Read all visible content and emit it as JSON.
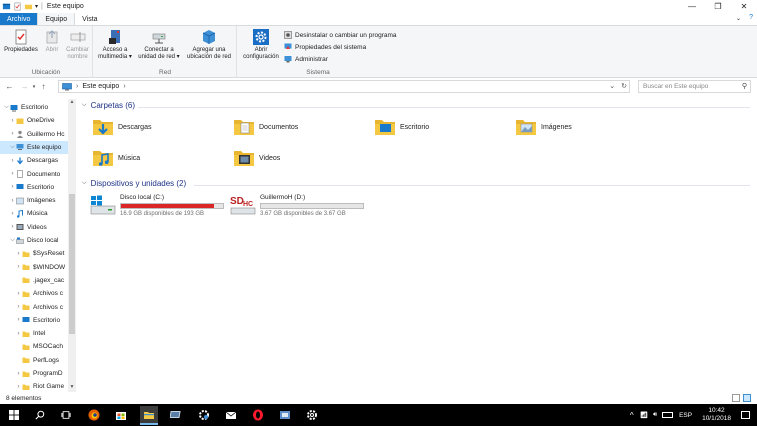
{
  "window": {
    "title": "Este equipo"
  },
  "tabs": [
    {
      "label": "Archivo"
    },
    {
      "label": "Equipo"
    },
    {
      "label": "Vista"
    }
  ],
  "ribbon": {
    "ubicacion": {
      "label": "Ubicación",
      "buttons": [
        {
          "label": "Propiedades",
          "enabled": true
        },
        {
          "label": "Abrir",
          "enabled": false
        },
        {
          "label": "Cambiar nombre",
          "enabled": false
        }
      ]
    },
    "red": {
      "label": "Red",
      "buttons": [
        {
          "label": "Acceso a multimedia ▾"
        },
        {
          "label": "Conectar a unidad de red ▾"
        },
        {
          "label": "Agregar una ubicación de red"
        }
      ]
    },
    "sistema": {
      "label": "Sistema",
      "open_settings": "Abrir configuración",
      "items": [
        {
          "label": "Desinstalar o cambiar un programa"
        },
        {
          "label": "Propiedades del sistema"
        },
        {
          "label": "Administrar"
        }
      ]
    }
  },
  "address": {
    "path": "Este equipo",
    "search_placeholder": "Buscar en Este equipo"
  },
  "nav_tree": [
    {
      "label": "Escritorio",
      "level": 0,
      "expanded": true
    },
    {
      "label": "OneDrive",
      "level": 1
    },
    {
      "label": "Guillermo Hc",
      "level": 1
    },
    {
      "label": "Este equipo",
      "level": 1,
      "expanded": true,
      "selected": true
    },
    {
      "label": "Descargas",
      "level": 2
    },
    {
      "label": "Documento",
      "level": 2
    },
    {
      "label": "Escritorio",
      "level": 2
    },
    {
      "label": "Imágenes",
      "level": 2
    },
    {
      "label": "Música",
      "level": 2
    },
    {
      "label": "Videos",
      "level": 2
    },
    {
      "label": "Disco local",
      "level": 2,
      "expanded": true
    },
    {
      "label": "$SysReset",
      "level": 3
    },
    {
      "label": "$WINDOW",
      "level": 3
    },
    {
      "label": ".jagex_cac",
      "level": 3
    },
    {
      "label": "Archivos c",
      "level": 3
    },
    {
      "label": "Archivos c",
      "level": 3
    },
    {
      "label": "Escritorio",
      "level": 3
    },
    {
      "label": "Intel",
      "level": 3
    },
    {
      "label": "MSOCach",
      "level": 3
    },
    {
      "label": "PerfLogs",
      "level": 3
    },
    {
      "label": "ProgramD",
      "level": 3
    },
    {
      "label": "Riot Game",
      "level": 3
    }
  ],
  "folders": {
    "heading": "Carpetas (6)",
    "items": [
      {
        "label": "Descargas",
        "icon": "downloads-folder-icon"
      },
      {
        "label": "Documentos",
        "icon": "documents-folder-icon"
      },
      {
        "label": "Escritorio",
        "icon": "desktop-folder-icon"
      },
      {
        "label": "Imágenes",
        "icon": "pictures-folder-icon"
      },
      {
        "label": "Música",
        "icon": "music-folder-icon"
      },
      {
        "label": "Videos",
        "icon": "videos-folder-icon"
      }
    ]
  },
  "drives": {
    "heading": "Dispositivos y unidades (2)",
    "items": [
      {
        "label": "Disco local (C:)",
        "free_text": "16.9 GB disponibles de 193 GB",
        "used_fraction": 0.91,
        "bar_color": "#da2626"
      },
      {
        "label": "GuillermoH (D:)",
        "free_text": "3.67 GB disponibles de 3.67 GB",
        "used_fraction": 0.0,
        "bar_color": "#26a0da"
      }
    ]
  },
  "status": {
    "count": "8 elementos"
  },
  "taskbar": {
    "lang": "ESP",
    "time": "10:42",
    "date": "10/1/2018"
  },
  "colors": {
    "accent": "#1979ca",
    "selection": "#cce8ff",
    "folder_yellow": "#f5c843",
    "heading_blue": "#1e3287"
  }
}
